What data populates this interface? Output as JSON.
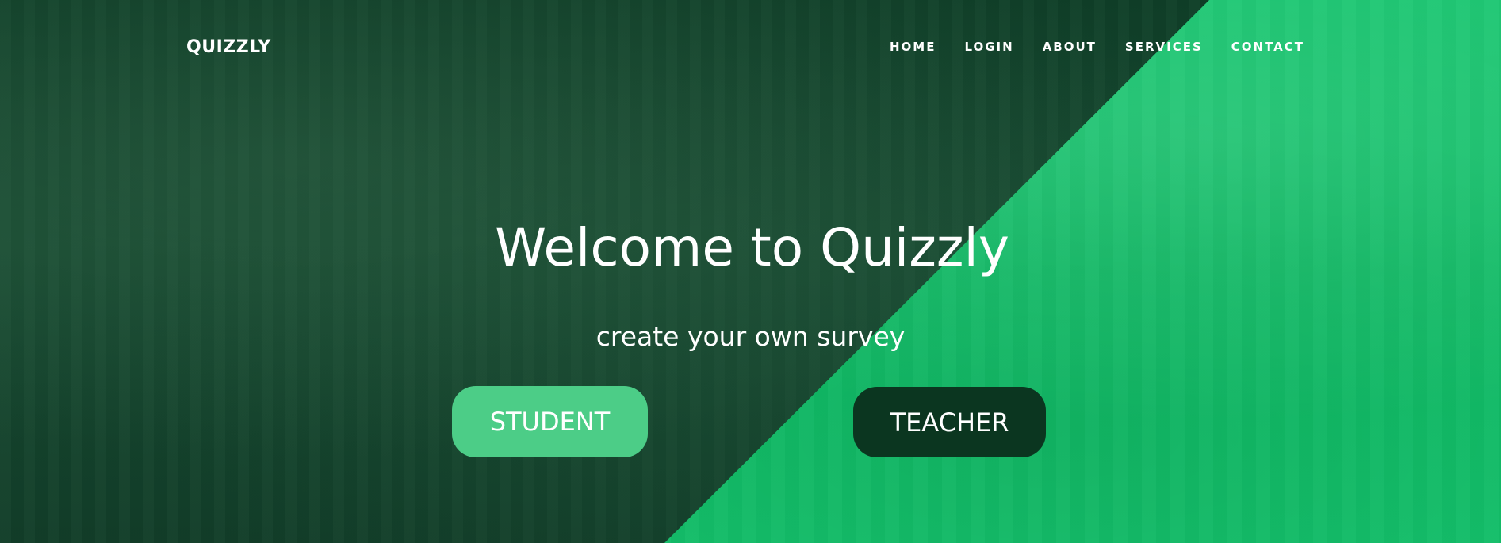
{
  "brand": "QUIZZLY",
  "nav": {
    "items": [
      {
        "label": "HOME"
      },
      {
        "label": "LOGIN"
      },
      {
        "label": "ABOUT"
      },
      {
        "label": "SERVICES"
      },
      {
        "label": "CONTACT"
      }
    ]
  },
  "hero": {
    "title": "Welcome to Quizzly",
    "subtitle": "create your own survey",
    "student_label": "STUDENT",
    "teacher_label": "TEACHER"
  },
  "colors": {
    "dark_overlay": "#14472e",
    "green_overlay": "#12c06a",
    "student_button": "#4ccd87",
    "teacher_button": "#0b3620"
  }
}
